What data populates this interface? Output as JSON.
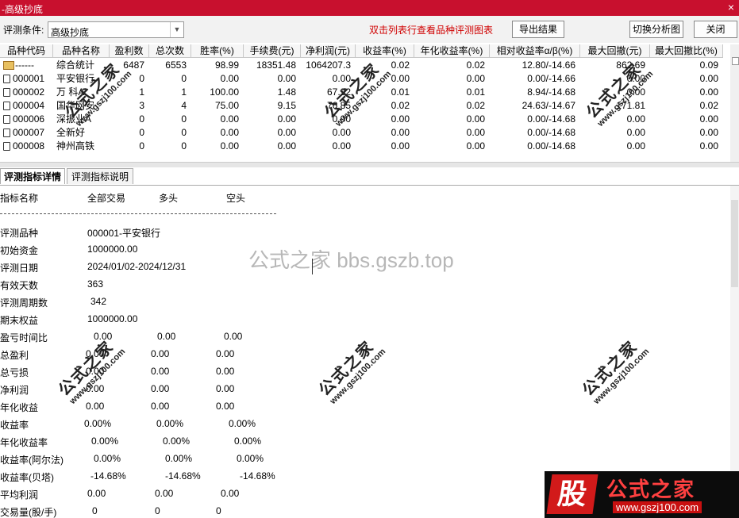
{
  "window": {
    "title": "-高级抄底",
    "close_glyph": "×"
  },
  "toolbar": {
    "condition_label": "评测条件:",
    "condition_value": "高级抄底",
    "hint": "双击列表行查看品种评测图表",
    "export_button": "导出结果",
    "switch_button": "切换分析图",
    "close_button": "关闭"
  },
  "grid": {
    "columns": [
      "品种代码",
      "品种名称",
      "盈利数",
      "总次数",
      "胜率(%)",
      "手续费(元)",
      "净利润(元)",
      "收益率(%)",
      "年化收益率(%)",
      "相对收益率α/β(%)",
      "最大回撤(元)",
      "最大回撤比(%)"
    ],
    "rows": [
      [
        "------",
        "综合统计",
        "6487",
        "6553",
        "98.99",
        "18351.48",
        "1064207.3",
        "0.02",
        "0.02",
        "12.80/-14.66",
        "862.69",
        "0.09"
      ],
      [
        "000001",
        "平安银行",
        "0",
        "0",
        "0.00",
        "0.00",
        "0.00",
        "0.00",
        "0.00",
        "0.00/-14.66",
        "0.00",
        "0.00"
      ],
      [
        "000002",
        "万 科A",
        "1",
        "1",
        "100.00",
        "1.48",
        "67.92",
        "0.01",
        "0.01",
        "8.94/-14.68",
        "0.00",
        "0.00"
      ],
      [
        "000004",
        "国华网安",
        "3",
        "4",
        "75.00",
        "9.15",
        "76.85",
        "0.02",
        "0.02",
        "24.63/-14.67",
        "171.81",
        "0.02"
      ],
      [
        "000006",
        "深振业A",
        "0",
        "0",
        "0.00",
        "0.00",
        "0.00",
        "0.00",
        "0.00",
        "0.00/-14.68",
        "0.00",
        "0.00"
      ],
      [
        "000007",
        "全新好",
        "0",
        "0",
        "0.00",
        "0.00",
        "0.00",
        "0.00",
        "0.00",
        "0.00/-14.68",
        "0.00",
        "0.00"
      ],
      [
        "000008",
        "神州高铁",
        "0",
        "0",
        "0.00",
        "0.00",
        "0.00",
        "0.00",
        "0.00",
        "0.00/-14.68",
        "0.00",
        "0.00"
      ]
    ]
  },
  "tabs": [
    "评测指标详情",
    "评测指标说明"
  ],
  "detail": {
    "header": [
      "指标名称",
      "全部交易",
      "多头",
      "空头"
    ],
    "rows": [
      [
        "评测品种",
        "000001-平安银行",
        "",
        ""
      ],
      [
        "初始资金",
        "1000000.00",
        "",
        ""
      ],
      [
        "评测日期",
        "2024/01/02-2024/12/31",
        "",
        ""
      ],
      [
        "有效天数",
        "363",
        "",
        ""
      ],
      [
        "评测周期数",
        "342",
        "",
        ""
      ],
      [
        "期末权益",
        "1000000.00",
        "",
        ""
      ],
      [
        "盈亏时间比",
        "0.00",
        "0.00",
        "0.00"
      ],
      [
        "总盈利",
        "0.00",
        "0.00",
        "0.00"
      ],
      [
        "总亏损",
        "0.00",
        "0.00",
        "0.00"
      ],
      [
        "净利润",
        "0.00",
        "0.00",
        "0.00"
      ],
      [
        "年化收益",
        "0.00",
        "0.00",
        "0.00"
      ],
      [
        "收益率",
        "0.00%",
        "0.00%",
        "0.00%"
      ],
      [
        "年化收益率",
        "0.00%",
        "0.00%",
        "0.00%"
      ],
      [
        "收益率(阿尔法)",
        "0.00%",
        "0.00%",
        "0.00%"
      ],
      [
        "收益率(贝塔)",
        "-14.68%",
        "-14.68%",
        "-14.68%"
      ],
      [
        "平均利润",
        "0.00",
        "0.00",
        "0.00"
      ],
      [
        "交易量(股/手)",
        "0",
        "0",
        "0"
      ]
    ]
  },
  "watermarks": {
    "center": "公式之家 bbs.gszb.top",
    "stamp_big": "公式之家",
    "stamp_small": "www.gszj100.com",
    "logo_glyph": "股",
    "logo_name": "公式之家",
    "logo_url": "www.gszj100.com"
  },
  "colors": {
    "titlebar": "#c8102e",
    "hint": "#d00000"
  }
}
